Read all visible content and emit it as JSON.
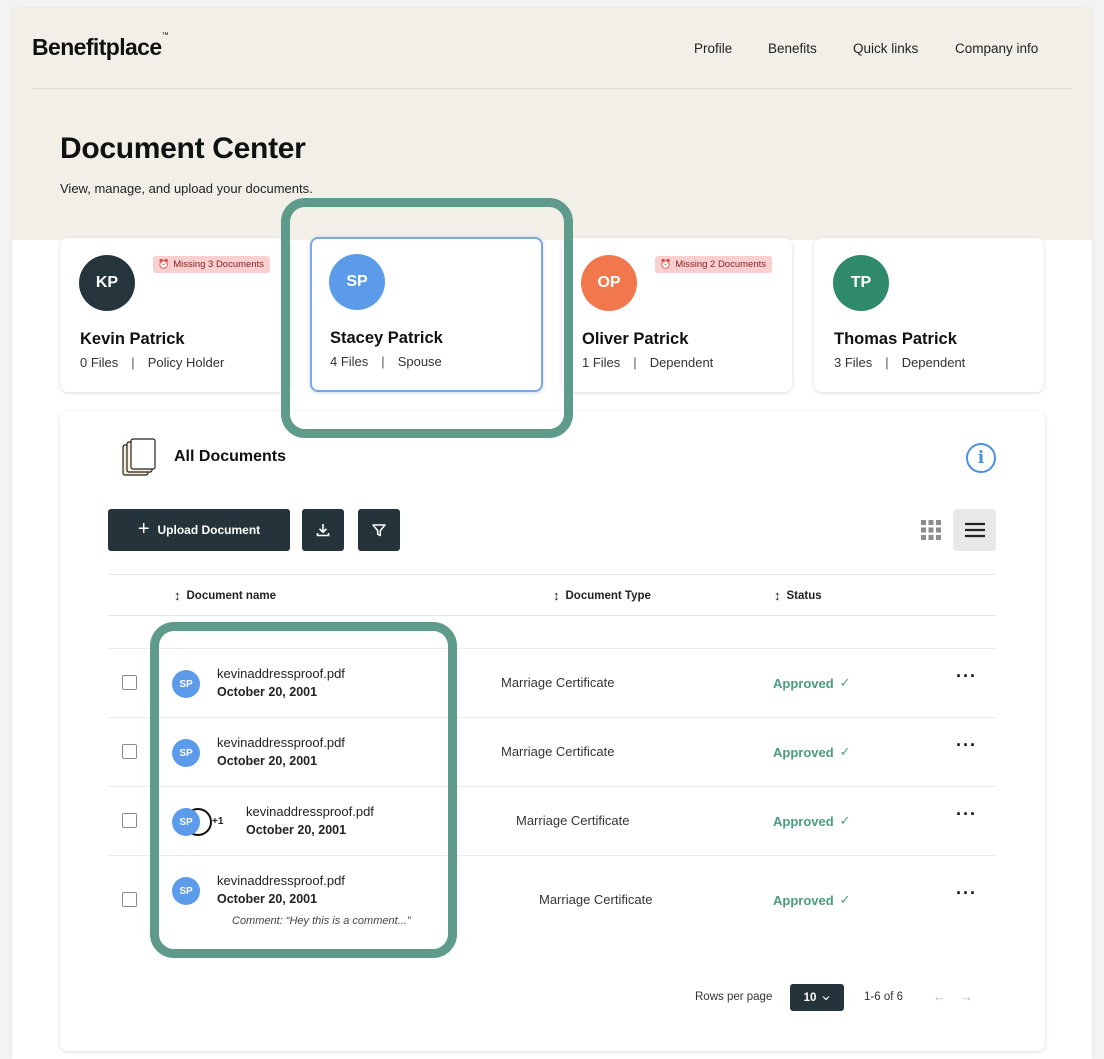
{
  "app": {
    "logo": "Benefitplace",
    "logo_mark": "™"
  },
  "nav": [
    "Profile",
    "Benefits",
    "Quick links",
    "Company info"
  ],
  "page": {
    "title": "Document Center",
    "subtitle": "View, manage, and upload your documents."
  },
  "members": [
    {
      "initials": "KP",
      "name": "Kevin Patrick",
      "files": "0 Files",
      "role": "Policy Holder",
      "badge": "Missing 3 Documents",
      "avatar_color": "#26353b"
    },
    {
      "initials": "SP",
      "name": "Stacey Patrick",
      "files": "4 Files",
      "role": "Spouse",
      "badge": "",
      "avatar_color": "#5b9bea"
    },
    {
      "initials": "OP",
      "name": "Oliver Patrick",
      "files": "1 Files",
      "role": "Dependent",
      "badge": "Missing 2 Documents",
      "avatar_color": "#f1784d"
    },
    {
      "initials": "TP",
      "name": "Thomas Patrick",
      "files": "3 Files",
      "role": "Dependent",
      "badge": "",
      "avatar_color": "#2e8a6b"
    }
  ],
  "documents": {
    "title": "All Documents",
    "upload_label": "Upload Document",
    "columns": [
      "Document name",
      "Document Type",
      "Status"
    ],
    "rows": [
      {
        "avatar": "SP",
        "extra": "",
        "filename": "kevinaddressproof.pdf",
        "date": "October 20, 2001",
        "type": "Marriage Certificate",
        "status": "Approved",
        "comment": ""
      },
      {
        "avatar": "SP",
        "extra": "",
        "filename": "kevinaddressproof.pdf",
        "date": "October 20, 2001",
        "type": "Marriage Certificate",
        "status": "Approved",
        "comment": ""
      },
      {
        "avatar": "SP",
        "extra": "+1",
        "filename": "kevinaddressproof.pdf",
        "date": "October 20, 2001",
        "type": "Marriage Certificate",
        "status": "Approved",
        "comment": ""
      },
      {
        "avatar": "SP",
        "extra": "",
        "filename": "kevinaddressproof.pdf",
        "date": "October 20, 2001",
        "type": "Marriage Certificate",
        "status": "Approved",
        "comment": "Comment: “Hey this is a comment...”"
      }
    ],
    "pagination": {
      "rows_label": "Rows per page",
      "rows_value": "10",
      "range": "1-6 of 6"
    }
  },
  "colors": {
    "accent_dark": "#25343a",
    "approved": "#4a9d7c",
    "annotation": "#5f9b8a",
    "badge_bg": "#f9cfcf",
    "hero_bg": "#f1efe8"
  },
  "icons": [
    "documents-stack-icon",
    "info-icon",
    "download-icon",
    "filter-icon",
    "grid-view-icon",
    "list-view-icon",
    "alarm-icon",
    "sort-icon",
    "check-icon",
    "chevron-down-icon",
    "arrow-left-icon",
    "arrow-right-icon",
    "more-icon"
  ]
}
